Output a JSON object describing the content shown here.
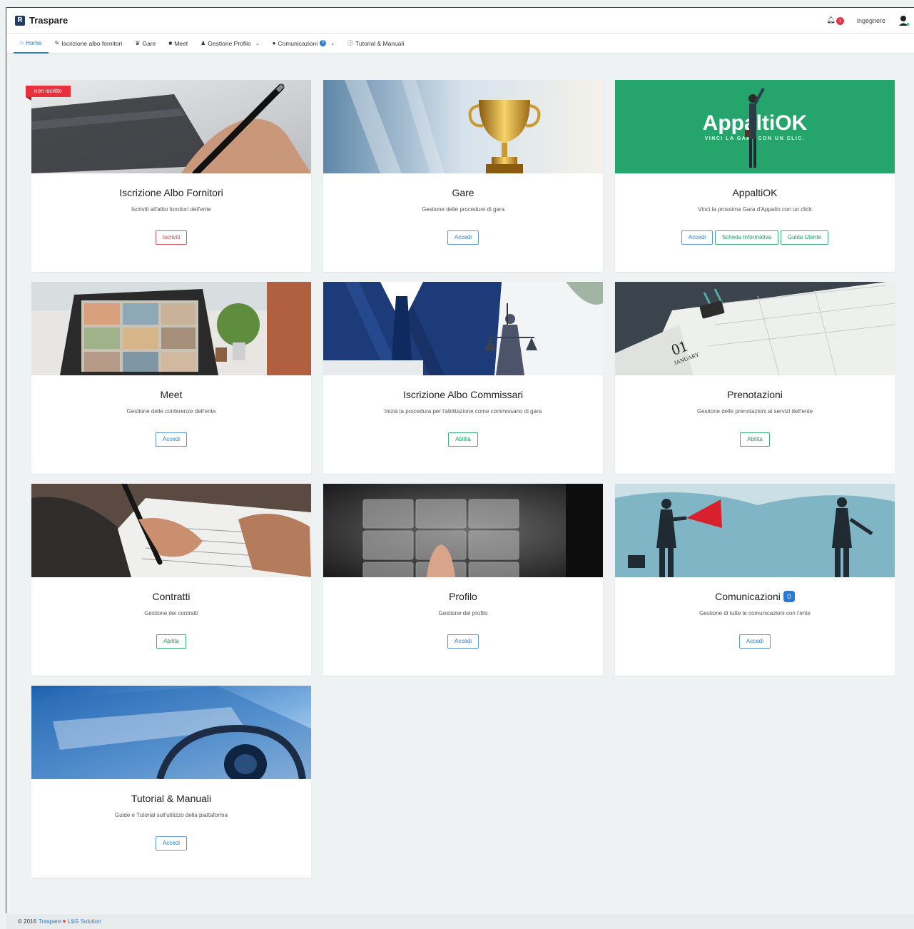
{
  "app": {
    "brand": "Traspare",
    "user": "ingegnere",
    "notifications": "1"
  },
  "nav": [
    {
      "label": "Home",
      "icon": "home-icon",
      "glyph": "⌂"
    },
    {
      "label": "Iscrizione albo fornitori",
      "icon": "pencil-icon",
      "glyph": "✎"
    },
    {
      "label": "Gare",
      "icon": "trophy-icon",
      "glyph": "♛"
    },
    {
      "label": "Meet",
      "icon": "video-icon",
      "glyph": "■"
    },
    {
      "label": "Gestione Profilo",
      "icon": "user-icon",
      "glyph": "♟"
    },
    {
      "label": "Comunicazioni",
      "icon": "comments-icon",
      "glyph": "●",
      "badge": "0"
    },
    {
      "label": "Tutorial & Manuali",
      "icon": "question-icon",
      "glyph": "?"
    }
  ],
  "cards": [
    {
      "title": "Iscrizione Albo Fornitori",
      "desc": "Iscriviti all'albo fornitori dell'ente",
      "ribbon": "non iscritto",
      "buttons": [
        "Iscriviti"
      ]
    },
    {
      "title": "Gare",
      "desc": "Gestione delle procedure di gara",
      "buttons": [
        "Accedi"
      ]
    },
    {
      "title": "AppaltiOK",
      "desc": "Vinci la prossima Gara d'Appalto con un click",
      "buttons": [
        "Accedi",
        "Scheda Informativa",
        "Guida Utente"
      ],
      "banner": {
        "logo": "AppaltiOK",
        "tagline": "VINCI LA GARA CON UN CLIC."
      }
    },
    {
      "title": "Meet",
      "desc": "Gestione delle conferenze dell'ente",
      "buttons": [
        "Accedi"
      ]
    },
    {
      "title": "Iscrizione Albo Commissari",
      "desc": "Inizia la procedura per l'abilitazione come commissario di gara",
      "buttons": [
        "Abilita"
      ]
    },
    {
      "title": "Prenotazioni",
      "desc": "Gestione delle prenotazioni ai servizi dell'ente",
      "buttons": [
        "Abilita"
      ],
      "calendar": {
        "day": "01",
        "month": "JANUARY"
      }
    },
    {
      "title": "Contratti",
      "desc": "Gestione dei contratti",
      "buttons": [
        "Abilita"
      ]
    },
    {
      "title": "Profilo",
      "desc": "Gestione del profilo",
      "buttons": [
        "Accedi"
      ]
    },
    {
      "title": "Comunicazioni",
      "desc": "Gestione di tutte le comunicazioni con l'ente",
      "buttons": [
        "Accedi"
      ],
      "badge": "0"
    },
    {
      "title": "Tutorial & Manuali",
      "desc": "Guide e Tutorial sull'utilizzo della piattaforma",
      "buttons": [
        "Accedi"
      ]
    }
  ],
  "footer": {
    "copyright": "© 2016",
    "link1": "Traspare",
    "link2": "L&G Solution"
  },
  "colors": {
    "primary": "#2a7ad2",
    "success": "#1e9d5f",
    "danger": "#e8313f",
    "appaltiok_green": "#25a56b"
  }
}
